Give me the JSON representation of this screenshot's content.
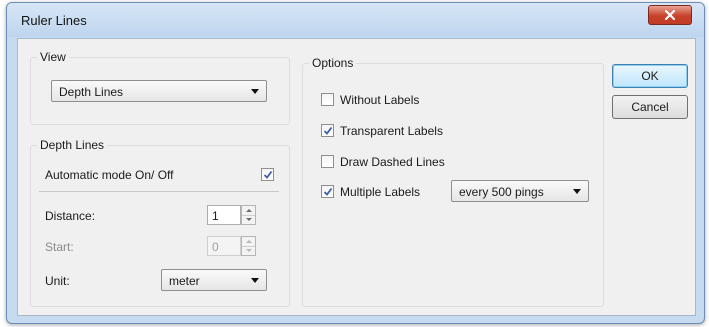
{
  "window": {
    "title": "Ruler Lines"
  },
  "view": {
    "group_label": "View",
    "selected": "Depth Lines"
  },
  "depth_lines": {
    "group_label": "Depth Lines",
    "automatic_mode_label": "Automatic mode On/ Off",
    "automatic_mode_checked": true,
    "distance_label": "Distance:",
    "distance_value": "1",
    "start_label": "Start:",
    "start_value": "0",
    "start_disabled": true,
    "unit_label": "Unit:",
    "unit_selected": "meter"
  },
  "options": {
    "group_label": "Options",
    "without_labels": {
      "label": "Without Labels",
      "checked": false
    },
    "transparent_labels": {
      "label": "Transparent Labels",
      "checked": true
    },
    "draw_dashed_lines": {
      "label": "Draw Dashed Lines",
      "checked": false
    },
    "multiple_labels": {
      "label": "Multiple Labels",
      "checked": true
    },
    "interval_selected": "every 500 pings"
  },
  "buttons": {
    "ok": "OK",
    "cancel": "Cancel"
  },
  "colors": {
    "close_button": "#c8412b",
    "title_bar": "#c6daf0",
    "dialog_bg": "#f0f0f0"
  }
}
